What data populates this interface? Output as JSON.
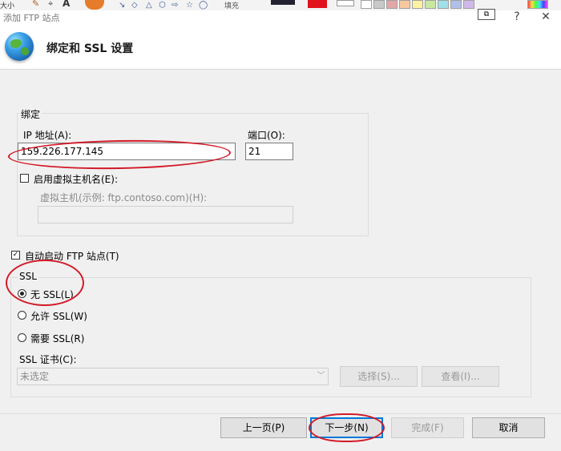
{
  "window": {
    "title": "添加 FTP 站点",
    "restore_glyph": "⧉",
    "help_glyph": "?",
    "close_glyph": "✕"
  },
  "background_toolbar": {
    "left_text": "大小",
    "fill_text": "填充"
  },
  "header": {
    "title": "绑定和 SSL 设置"
  },
  "binding": {
    "legend": "绑定",
    "ip_label": "IP 地址(A):",
    "ip_value": "159.226.177.145",
    "port_label": "端口(O):",
    "port_value": "21",
    "virtual_host_checkbox_label": "启用虚拟主机名(E):",
    "virtual_host_label": "虚拟主机(示例: ftp.contoso.com)(H):",
    "virtual_host_value": ""
  },
  "auto_start": {
    "checked": true,
    "label": "自动启动 FTP 站点(T)"
  },
  "ssl": {
    "legend": "SSL",
    "options": [
      {
        "label": "无 SSL(L)",
        "selected": true
      },
      {
        "label": "允许 SSL(W)",
        "selected": false
      },
      {
        "label": "需要 SSL(R)",
        "selected": false
      }
    ],
    "cert_label": "SSL 证书(C):",
    "cert_value": "未选定",
    "select_button": "选择(S)...",
    "view_button": "查看(I)..."
  },
  "footer": {
    "prev_button": "上一页(P)",
    "next_button": "下一步(N)",
    "finish_button": "完成(F)",
    "cancel_button": "取消"
  },
  "colors": {
    "annotation": "#d21a27",
    "accent": "#0078d7"
  }
}
